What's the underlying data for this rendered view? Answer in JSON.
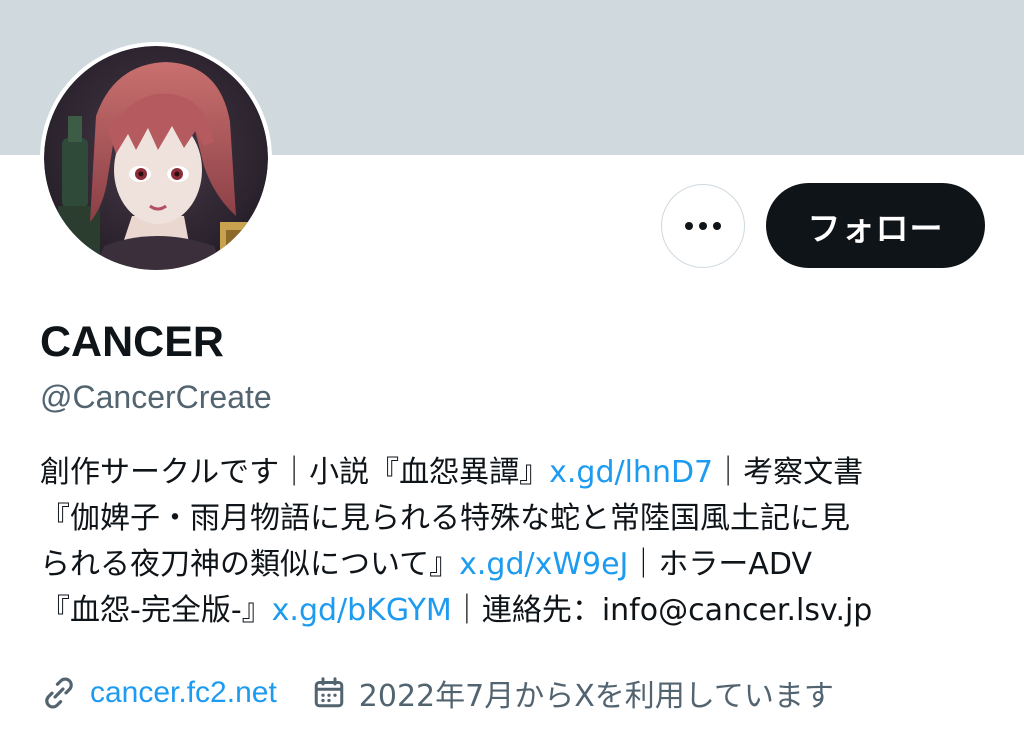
{
  "profile": {
    "display_name": "CANCER",
    "handle": "@CancerCreate"
  },
  "actions": {
    "more_icon": "more-horizontal-icon",
    "follow_label": "フォロー"
  },
  "bio": {
    "line1_a": "創作サークルです｜小説『血怨異譚』",
    "line1_link": "x.gd/lhnD7",
    "line1_b": "｜考察文書",
    "line2": "『伽婢子・雨月物語に見られる特殊な蛇と常陸国風土記に見",
    "line3_a": "られる夜刀神の類似について』",
    "line3_link": "x.gd/xW9eJ",
    "line3_b": "｜ホラーADV",
    "line4_a": "『血怨-完全版-』",
    "line4_link": "x.gd/bKGYM",
    "line4_b": "｜連絡先：info@cancer.lsv.jp"
  },
  "meta": {
    "link_icon": "link-icon",
    "website": "cancer.fc2.net",
    "calendar_icon": "calendar-icon",
    "joined": "2022年7月からXを利用しています"
  },
  "colors": {
    "banner": "#cfd9de",
    "link": "#1d9bf0",
    "text_primary": "#0f1419",
    "text_secondary": "#536471",
    "follow_bg": "#0f1419"
  }
}
